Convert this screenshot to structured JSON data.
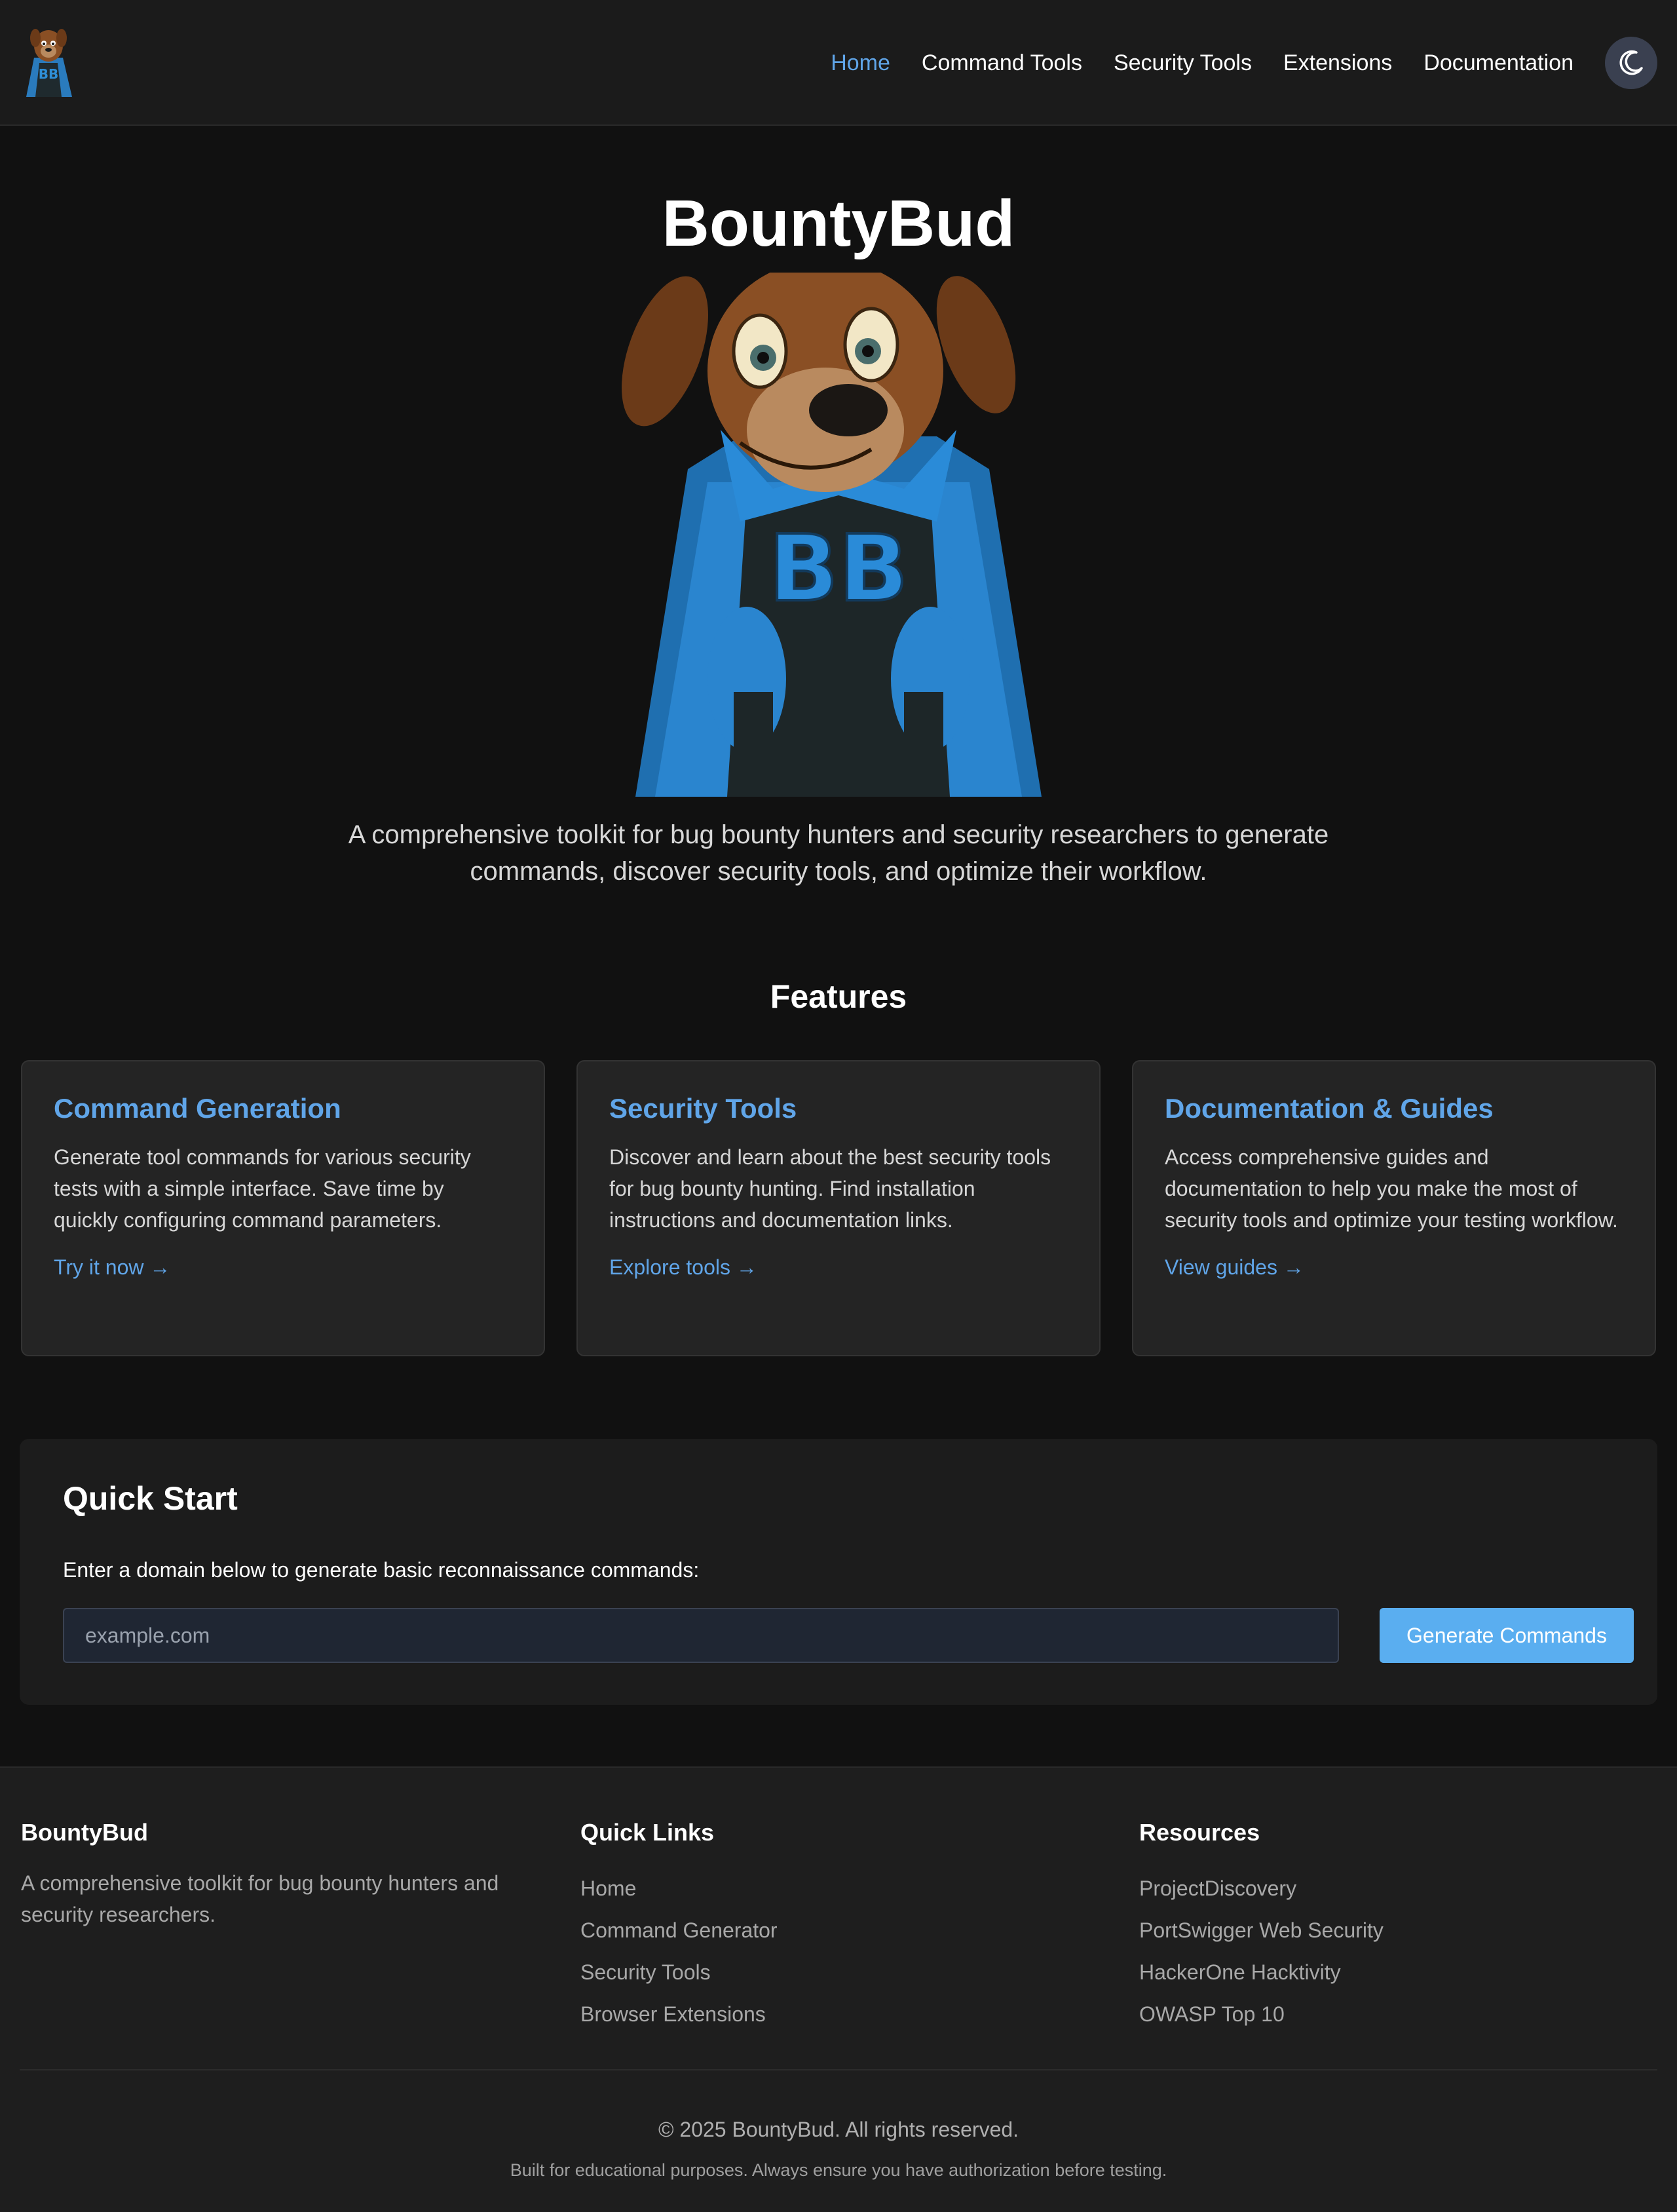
{
  "nav": {
    "items": [
      {
        "label": "Home",
        "active": true
      },
      {
        "label": "Command Tools",
        "active": false
      },
      {
        "label": "Security Tools",
        "active": false
      },
      {
        "label": "Extensions",
        "active": false
      },
      {
        "label": "Documentation",
        "active": false
      }
    ],
    "theme_icon": "moon-icon"
  },
  "hero": {
    "title": "BountyBud",
    "mascot_emblem": "BB",
    "description": "A comprehensive toolkit for bug bounty hunters and security researchers to generate commands, discover security tools, and optimize their workflow."
  },
  "features": {
    "title": "Features",
    "cards": [
      {
        "title": "Command Generation",
        "text": "Generate tool commands for various security tests with a simple interface. Save time by quickly configuring command parameters.",
        "link": "Try it now →"
      },
      {
        "title": "Security Tools",
        "text": "Discover and learn about the best security tools for bug bounty hunting. Find installation instructions and documentation links.",
        "link": "Explore tools →"
      },
      {
        "title": "Documentation & Guides",
        "text": "Access comprehensive guides and documentation to help you make the most of security tools and optimize your testing workflow.",
        "link": "View guides →"
      }
    ]
  },
  "quick_start": {
    "title": "Quick Start",
    "label": "Enter a domain below to generate basic reconnaissance commands:",
    "placeholder": "example.com",
    "value": "",
    "button": "Generate Commands"
  },
  "footer": {
    "about": {
      "title": "BountyBud",
      "text": "A comprehensive toolkit for bug bounty hunters and security researchers."
    },
    "quick_links": {
      "title": "Quick Links",
      "items": [
        "Home",
        "Command Generator",
        "Security Tools",
        "Browser Extensions"
      ]
    },
    "resources": {
      "title": "Resources",
      "items": [
        "ProjectDiscovery",
        "PortSwigger Web Security",
        "HackerOne Hacktivity",
        "OWASP Top 10"
      ]
    },
    "copyright": "© 2025 BountyBud. All rights reserved.",
    "disclaimer": "Built for educational purposes. Always ensure you have authorization before testing."
  },
  "colors": {
    "accent": "#60a5e8",
    "button": "#5aaef0",
    "background": "#111111",
    "card": "#242424"
  }
}
